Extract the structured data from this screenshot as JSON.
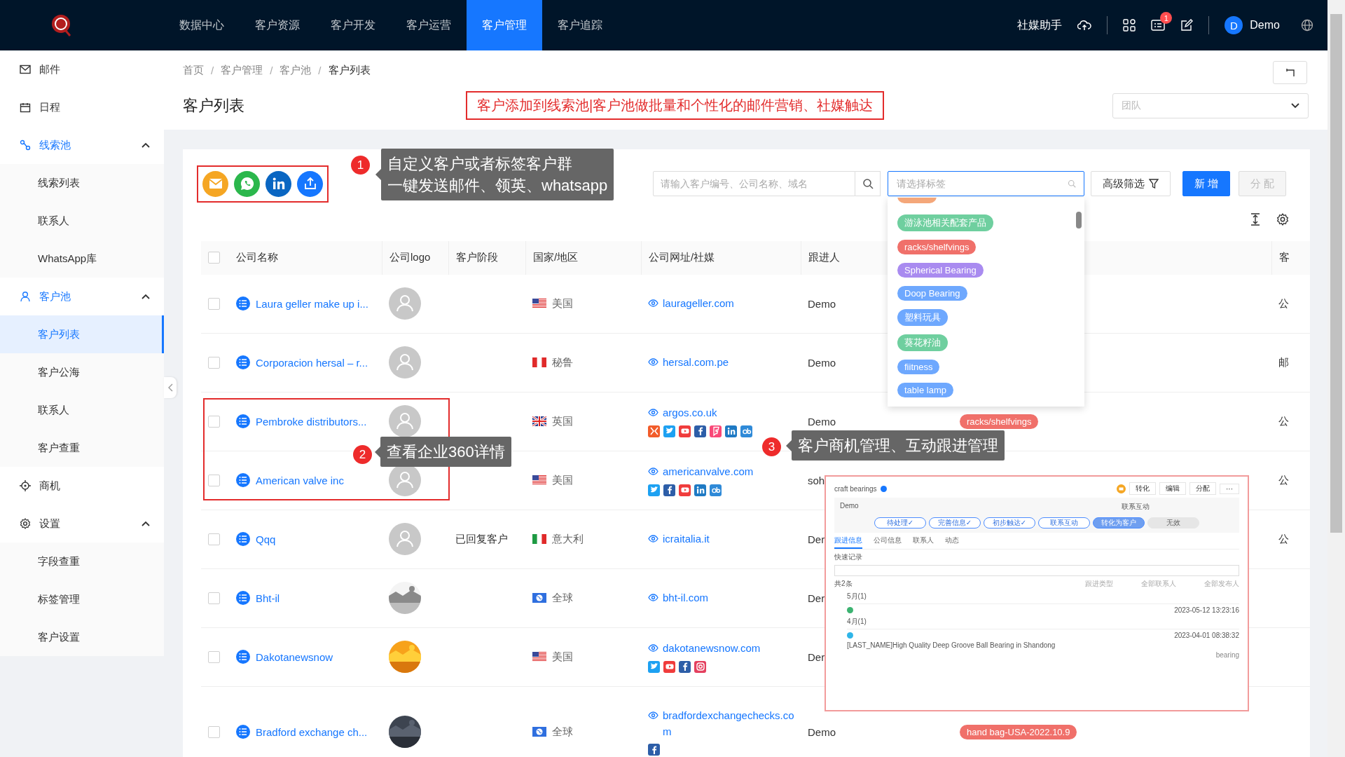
{
  "top_nav": {
    "items": [
      {
        "label": "数据中心",
        "selected": false
      },
      {
        "label": "客户资源",
        "selected": false
      },
      {
        "label": "客户开发",
        "selected": false
      },
      {
        "label": "客户运营",
        "selected": false
      },
      {
        "label": "客户管理",
        "selected": true
      },
      {
        "label": "客户追踪",
        "selected": false
      }
    ],
    "assistant": "社媒助手",
    "notification_count": "1",
    "user": {
      "initial": "D",
      "name": "Demo"
    }
  },
  "sidebar": {
    "items": [
      {
        "label": "邮件",
        "selected": false
      },
      {
        "label": "日程",
        "selected": false
      },
      {
        "label": "线索池",
        "selected": true,
        "expanded": true,
        "children": [
          {
            "label": "线索列表",
            "selected": false
          },
          {
            "label": "联系人",
            "selected": false
          },
          {
            "label": "WhatsApp库",
            "selected": false
          }
        ]
      },
      {
        "label": "客户池",
        "selected": true,
        "expanded": true,
        "children": [
          {
            "label": "客户列表",
            "selected": true
          },
          {
            "label": "客户公海",
            "selected": false
          },
          {
            "label": "联系人",
            "selected": false
          },
          {
            "label": "客户查重",
            "selected": false
          }
        ]
      },
      {
        "label": "商机",
        "selected": false
      },
      {
        "label": "设置",
        "selected": false,
        "expanded": true,
        "children": [
          {
            "label": "字段查重",
            "selected": false
          },
          {
            "label": "标签管理",
            "selected": false
          },
          {
            "label": "客户设置",
            "selected": false
          }
        ]
      }
    ]
  },
  "breadcrumb": [
    {
      "label": "首页",
      "separator": "/"
    },
    {
      "label": "客户管理",
      "separator": "/"
    },
    {
      "label": "客户池",
      "separator": "/"
    },
    {
      "label": "客户列表"
    }
  ],
  "page_title": "客户列表",
  "banner": "客户添加到线索池|客户池做批量和个性化的邮件营销、社媒触达",
  "team_select": {
    "placeholder": "团队"
  },
  "toolbar": {
    "search": {
      "placeholder": "请输入客户编号、公司名称、域名"
    },
    "tag_select": {
      "placeholder": "请选择标签"
    },
    "filter_button": "高级筛选",
    "add_button": "新 增",
    "assign_button": {
      "label": "分 配",
      "disabled": true
    }
  },
  "tag_dropdown": [
    {
      "color": "#f4a77a"
    },
    {
      "label": "游泳池相关配套产品",
      "color": "#6fcf9f"
    },
    {
      "label": "racks/shelfvings",
      "color": "#f0706a"
    },
    {
      "label": "Spherical Bearing",
      "color": "#a98bf0"
    },
    {
      "label": "Doop Bearing",
      "color": "#6ea8fe"
    },
    {
      "label": "塑料玩具",
      "color": "#6ea8fe"
    },
    {
      "label": "葵花籽油",
      "color": "#6fcf9f"
    },
    {
      "label": "fiitness",
      "color": "#6ea8fe"
    },
    {
      "label": "table lamp",
      "color": "#6ea8fe"
    }
  ],
  "table": {
    "select_all": {
      "checked": false
    },
    "columns": [
      "公司名称",
      "公司logo",
      "客户阶段",
      "国家/地区",
      "公司网址/社媒",
      "跟进人",
      "客"
    ],
    "rows": [
      {
        "checked": false,
        "company": "Laura geller make up i...",
        "stage": "",
        "country": "美国",
        "website": "laurageller.com",
        "follower": "Demo",
        "tags": [],
        "column_7": "公"
      },
      {
        "checked": false,
        "company": "Corporacion hersal – r...",
        "stage": "",
        "country": "秘鲁",
        "website": "hersal.com.pe",
        "follower": "Demo",
        "tags": [],
        "column_7": "邮"
      },
      {
        "checked": false,
        "company": "Pembroke distributors...",
        "stage": "",
        "country": "英国",
        "website": "argos.co.uk",
        "follower": "Demo",
        "tags": [
          {
            "label": "racks/shelfvings",
            "color": "#f0706a"
          }
        ],
        "column_7": "公"
      },
      {
        "checked": false,
        "company": "American valve inc",
        "stage": "",
        "country": "美国",
        "website": "americanvalve.com",
        "follower": "soh",
        "tags": [],
        "column_7": "公"
      },
      {
        "checked": false,
        "company": "Qqq",
        "stage": "已回复客户",
        "country": "意大利",
        "website": "icraitalia.it",
        "follower": "Der",
        "tags": [],
        "column_7": "公"
      },
      {
        "checked": false,
        "company": "Bht-il",
        "stage": "",
        "country": "全球",
        "website": "bht-il.com",
        "follower": "Der",
        "tags": [],
        "column_7": ""
      },
      {
        "checked": false,
        "company": "Dakotanewsnow",
        "stage": "",
        "country": "美国",
        "website": "dakotanewsnow.com",
        "follower": "Der",
        "tags": [],
        "column_7": ""
      },
      {
        "checked": false,
        "company": "Bradford exchange ch...",
        "stage": "",
        "country": "全球",
        "website": "bradfordexchangechecks.com",
        "follower": "Demo",
        "tags": [
          {
            "label": "hand bag-USA-2022.10.9",
            "color": "#f0706a"
          }
        ],
        "column_7": ""
      }
    ]
  },
  "annotations": [
    {
      "number": "1",
      "lines": [
        "自定义客户或者标签客户群",
        "一键发送邮件、领英、whatsapp"
      ]
    },
    {
      "number": "2",
      "lines": [
        "查看企业360详情"
      ]
    },
    {
      "number": "3",
      "lines": [
        "客户商机管理、互动跟进管理"
      ]
    }
  ],
  "detail_preview": {
    "company": "craft bearings",
    "buttons": [
      "转化",
      "编辑",
      "分配",
      "···"
    ],
    "owner": "Demo",
    "status": "联系互动",
    "steps": [
      {
        "label": "待处理✓",
        "kind": "done"
      },
      {
        "label": "完善信息✓",
        "kind": "done"
      },
      {
        "label": "初步触达✓",
        "kind": "done"
      },
      {
        "label": "联系互动",
        "kind": "done"
      },
      {
        "label": "转化为客户",
        "kind": "current"
      },
      {
        "label": "无效",
        "kind": "inactive"
      }
    ],
    "tabs": [
      {
        "label": "跟进信息",
        "selected": true
      },
      {
        "label": "公司信息",
        "selected": false
      },
      {
        "label": "联系人",
        "selected": false
      },
      {
        "label": "动态",
        "selected": false
      }
    ],
    "quick_record": "快速记录",
    "count": "共2条",
    "filters": [
      "跟进类型",
      "全部联系人",
      "全部发布人"
    ],
    "groups": [
      {
        "month": "5月(1)",
        "time": "2023-05-12 13:23:16"
      },
      {
        "month": "4月(1)",
        "time": "2023-04-01 08:38:32",
        "line": "[LAST_NAME]High Quality Deep Groove Ball Bearing in Shandong",
        "note": "bearing"
      }
    ]
  }
}
